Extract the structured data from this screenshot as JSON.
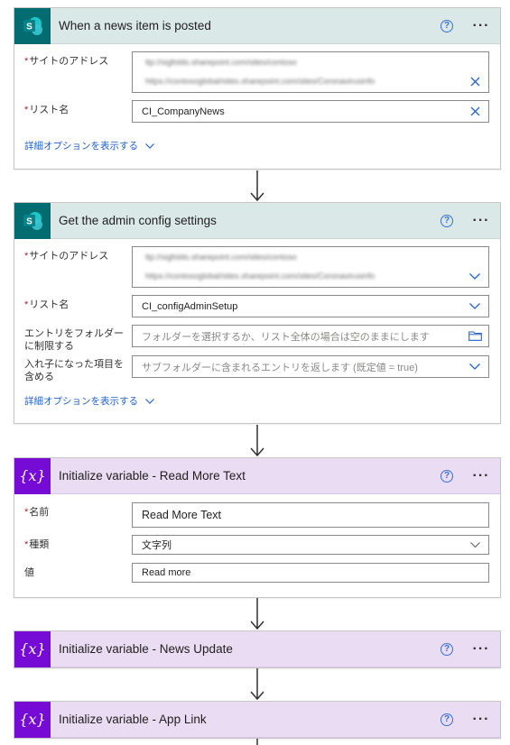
{
  "cards": {
    "news": {
      "title": "When a news item is posted",
      "site_label": "サイトのアドレス",
      "site_line1": "ttp://sigfoldo.sharepoint.com/sites/contoso",
      "site_line2": "https://contosoglobal/sites.sharepoint.com/sites/Coronavirusinfo",
      "list_label": "リスト名",
      "list_value": "CI_CompanyNews",
      "advanced": "詳細オプションを表示する"
    },
    "admin": {
      "title": "Get the admin config settings",
      "site_label": "サイトのアドレス",
      "site_line1": "ttp://sigfoldo.sharepoint.com/sites/contoso",
      "site_line2": "https://contosoglobal/sites.sharepoint.com/sites/Coronavirusinfo",
      "list_label": "リスト名",
      "list_value": "CI_configAdminSetup",
      "folder_label": "エントリをフォルダーに制限する",
      "folder_placeholder": "フォルダーを選択するか、リスト全体の場合は空のままにします",
      "nested_label": "入れ子になった項目を含める",
      "nested_placeholder": "サブフォルダーに含まれるエントリを返します (既定値 = true)",
      "advanced": "詳細オプションを表示する"
    },
    "readmore": {
      "title": "Initialize variable - Read More Text",
      "name_label": "名前",
      "name_value": "Read More Text",
      "type_label": "種類",
      "type_value": "文字列",
      "value_label": "値",
      "value_value": "Read more"
    },
    "newsupdate": {
      "title": "Initialize variable - News Update"
    },
    "applink": {
      "title": "Initialize variable - App Link"
    }
  },
  "help_glyph": "?",
  "more_glyph": "···",
  "required_mark": "*",
  "icons": {
    "sharepoint": "sharepoint-icon",
    "variable": "variable-icon",
    "variable_glyph": "{x}",
    "sp_letter": "S"
  },
  "colors": {
    "sharepoint_accent": "#036c70",
    "variable_accent": "#770bd6",
    "sp_header_bg": "#dbe8e8",
    "var_header_bg": "#e9dcf3",
    "link": "#2563c5"
  }
}
